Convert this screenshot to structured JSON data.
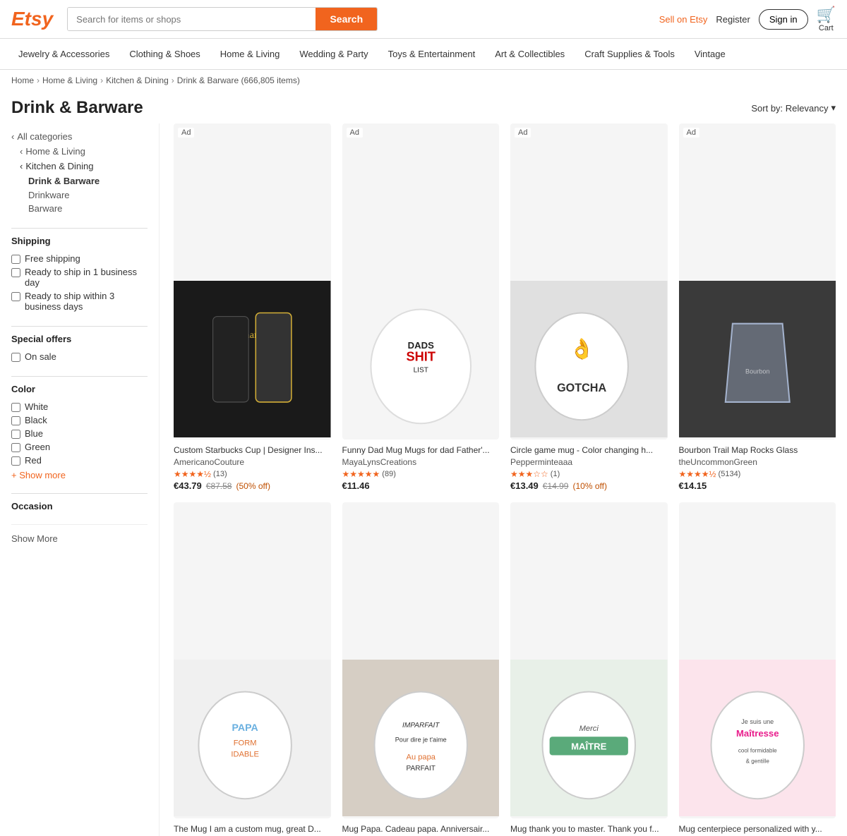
{
  "header": {
    "logo": "Etsy",
    "search_placeholder": "Search for items or shops",
    "search_button": "Search",
    "sell_label": "Sell on Etsy",
    "register_label": "Register",
    "signin_label": "Sign in",
    "cart_label": "Cart"
  },
  "nav": {
    "items": [
      {
        "label": "Jewelry & Accessories"
      },
      {
        "label": "Clothing & Shoes"
      },
      {
        "label": "Home & Living"
      },
      {
        "label": "Wedding & Party"
      },
      {
        "label": "Toys & Entertainment"
      },
      {
        "label": "Art & Collectibles"
      },
      {
        "label": "Craft Supplies & Tools"
      },
      {
        "label": "Vintage"
      }
    ]
  },
  "breadcrumb": {
    "items": [
      "Home",
      "Home & Living",
      "Kitchen & Dining",
      "Drink & Barware (666,805 items)"
    ]
  },
  "page": {
    "title": "Drink & Barware",
    "sort_label": "Sort by: Relevancy"
  },
  "sidebar": {
    "categories": {
      "all_label": "All categories",
      "home_living_label": "Home & Living",
      "kitchen_dining_label": "Kitchen & Dining",
      "drink_barware_label": "Drink & Barware",
      "drinkware_label": "Drinkware",
      "barware_label": "Barware"
    },
    "shipping": {
      "title": "Shipping",
      "options": [
        {
          "label": "Free shipping"
        },
        {
          "label": "Ready to ship in 1 business day"
        },
        {
          "label": "Ready to ship within 3 business days"
        }
      ]
    },
    "special_offers": {
      "title": "Special offers",
      "options": [
        {
          "label": "On sale"
        }
      ]
    },
    "color": {
      "title": "Color",
      "options": [
        {
          "label": "White"
        },
        {
          "label": "Black"
        },
        {
          "label": "Blue"
        },
        {
          "label": "Green"
        },
        {
          "label": "Red"
        }
      ],
      "show_more": "+ Show more"
    },
    "occasion": {
      "title": "Occasion"
    },
    "show_more_sidebar": "Show More"
  },
  "products": [
    {
      "id": 1,
      "ad": true,
      "title": "Custom Starbucks Cup | Designer Ins...",
      "shop": "AmericanoCouture",
      "stars": 4.5,
      "review_count": 13,
      "price": "€43.79",
      "original_price": "€87.58",
      "discount": "(50% off)",
      "bg_color": "#1a1a1a",
      "img_desc": "Black designer cups Chanel Gucci D&G"
    },
    {
      "id": 2,
      "ad": true,
      "title": "Funny Dad Mug Mugs for dad Father'...",
      "shop": "MayaLynsCreations",
      "stars": 5,
      "review_count": 89,
      "price": "€11.46",
      "original_price": null,
      "discount": null,
      "bg_color": "#f5f5f5",
      "img_desc": "White mug Dads Shit List"
    },
    {
      "id": 3,
      "ad": true,
      "title": "Circle game mug - Color changing h...",
      "shop": "Pepperminteaaa",
      "stars": 3,
      "review_count": 1,
      "price": "€13.49",
      "original_price": "€14.99",
      "discount": "(10% off)",
      "bg_color": "#e8e8e8",
      "img_desc": "White mug GOTCHA hand gesture"
    },
    {
      "id": 4,
      "ad": true,
      "title": "Bourbon Trail Map Rocks Glass",
      "shop": "theUncommonGreen",
      "stars": 4.5,
      "review_count": 5134,
      "price": "€14.15",
      "original_price": null,
      "discount": null,
      "bg_color": "#444",
      "img_desc": "Clear rocks glass dark background"
    },
    {
      "id": 5,
      "ad": false,
      "title": "The Mug I am a custom mug, great D...",
      "shop": "",
      "stars": 0,
      "review_count": 0,
      "price": null,
      "original_price": null,
      "discount": null,
      "bg_color": "#f0f0f0",
      "img_desc": "White mug PAPA FORMIDABLE text"
    },
    {
      "id": 6,
      "ad": false,
      "title": "Mug Papa. Cadeau papa. Anniversair...",
      "shop": "",
      "stars": 0,
      "review_count": 0,
      "price": null,
      "original_price": null,
      "discount": null,
      "bg_color": "#e5e0d8",
      "img_desc": "White mug IMPARFAIT pour dire je t'aime"
    },
    {
      "id": 7,
      "ad": false,
      "title": "Mug thank you to master. Thank you f...",
      "shop": "",
      "stars": 0,
      "review_count": 0,
      "price": null,
      "original_price": null,
      "discount": null,
      "bg_color": "#e8f0e8",
      "img_desc": "White mug Merci MAITRE"
    },
    {
      "id": 8,
      "ad": false,
      "title": "Mug centerpiece personalized with y...",
      "shop": "",
      "stars": 0,
      "review_count": 0,
      "price": null,
      "original_price": null,
      "discount": null,
      "bg_color": "#fce4ec",
      "img_desc": "White mug Maitresse text"
    }
  ],
  "show_more": "Show More"
}
